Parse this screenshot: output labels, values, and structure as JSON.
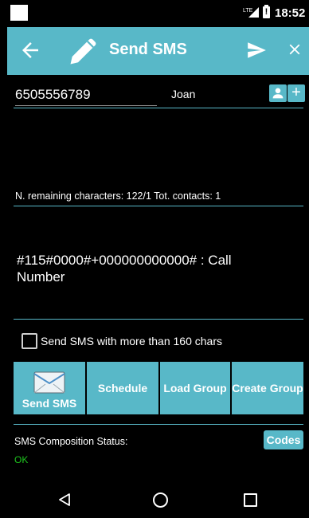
{
  "status_bar": {
    "network": "LTE",
    "time": "18:52"
  },
  "app_bar": {
    "title": "Send SMS"
  },
  "recipient": {
    "phone": "6505556789",
    "name": "Joan"
  },
  "counters": {
    "text": "N. remaining characters:  122/1   Tot. contacts:  1"
  },
  "message": {
    "text": "#115#0000#+000000000000# : Call Number"
  },
  "options": {
    "long_sms_label": "Send SMS with more than 160 chars"
  },
  "buttons": {
    "send": "Send SMS",
    "schedule": "Schedule",
    "load_group": "Load Group",
    "create_group": "Create Group",
    "codes": "Codes"
  },
  "composition": {
    "label": "SMS Composition Status:",
    "status": "OK"
  },
  "colors": {
    "accent": "#58b8c8",
    "ok": "#1ec51e"
  },
  "icons": [
    "back-arrow-icon",
    "pencil-icon",
    "send-icon",
    "close-icon",
    "contact-icon",
    "add-icon",
    "envelope-icon"
  ]
}
